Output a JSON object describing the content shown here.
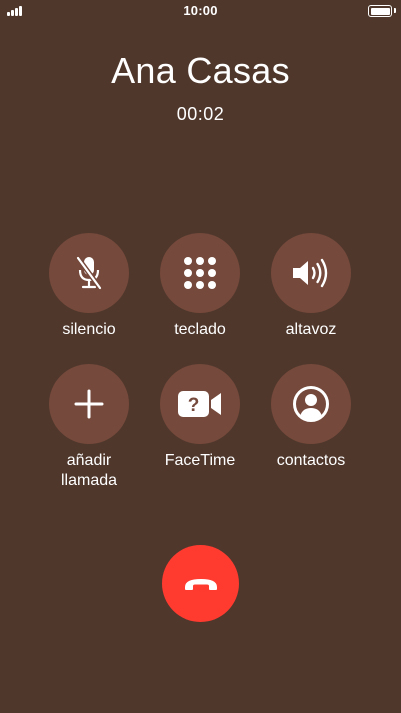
{
  "status_bar": {
    "time": "10:00",
    "signal_icon": "signal-bars-icon",
    "battery_icon": "battery-icon",
    "battery_level": 1.0
  },
  "call": {
    "caller_name": "Ana Casas",
    "duration": "00:02"
  },
  "controls": [
    {
      "label": "silencio",
      "icon": "microphone-muted-icon"
    },
    {
      "label": "teclado",
      "icon": "keypad-icon"
    },
    {
      "label": "altavoz",
      "icon": "speaker-icon"
    },
    {
      "label": "añadir\nllamada",
      "icon": "plus-icon"
    },
    {
      "label": "FaceTime",
      "icon": "facetime-icon"
    },
    {
      "label": "contactos",
      "icon": "contact-icon"
    }
  ],
  "end_call": {
    "icon": "end-call-icon",
    "color": "#ff3b30"
  },
  "colors": {
    "background": "#4f372c",
    "control_button": "#75493b",
    "text": "#ffffff"
  }
}
